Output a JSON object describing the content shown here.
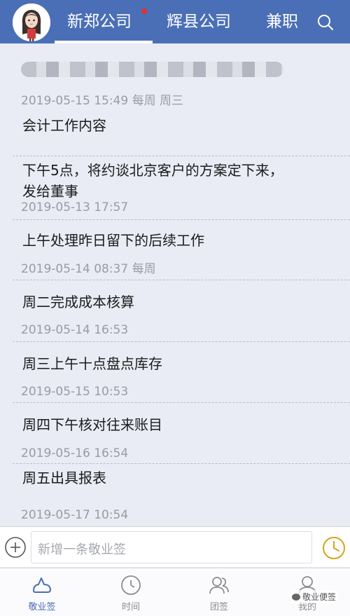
{
  "header": {
    "tabs": [
      {
        "label": "新郑公司",
        "active": true,
        "has_notification_dot": true
      },
      {
        "label": "辉县公司",
        "active": false
      },
      {
        "label": "兼职",
        "active": false
      }
    ],
    "search_icon": "search-icon",
    "accent_color": "#4a6fb6",
    "notification_color": "#e0322c"
  },
  "notes": [
    {
      "title": "",
      "meta": "2019-05-15 15:49 每周 周三"
    },
    {
      "title": "会计工作内容",
      "meta": ""
    },
    {
      "title": "下午5点，将约谈北京客户的方案定下来，\n发给董事",
      "meta": "2019-05-13 17:57"
    },
    {
      "title": "上午处理昨日留下的后续工作",
      "meta": "2019-05-14 08:37 每周"
    },
    {
      "title": "周二完成成本核算",
      "meta": "2019-05-14 16:53"
    },
    {
      "title": "周三上午十点盘点库存",
      "meta": "2019-05-15 10:53"
    },
    {
      "title": "周四下午核对往来账目",
      "meta": "2019-05-16 16:54"
    },
    {
      "title": "周五出具报表",
      "meta": "2019-05-17 10:54"
    }
  ],
  "input_bar": {
    "placeholder": "新增一条敬业签",
    "add_icon": "plus-circle-icon",
    "reminder_icon": "clock-icon"
  },
  "bottom_nav": {
    "items": [
      {
        "label": "敬业签",
        "icon": "cloud-icon",
        "active": true
      },
      {
        "label": "时间",
        "icon": "clock-icon",
        "active": false
      },
      {
        "label": "团签",
        "icon": "team-icon",
        "active": false
      },
      {
        "label": "我的",
        "icon": "person-icon",
        "active": false
      }
    ]
  },
  "watermark": "敬业便签"
}
